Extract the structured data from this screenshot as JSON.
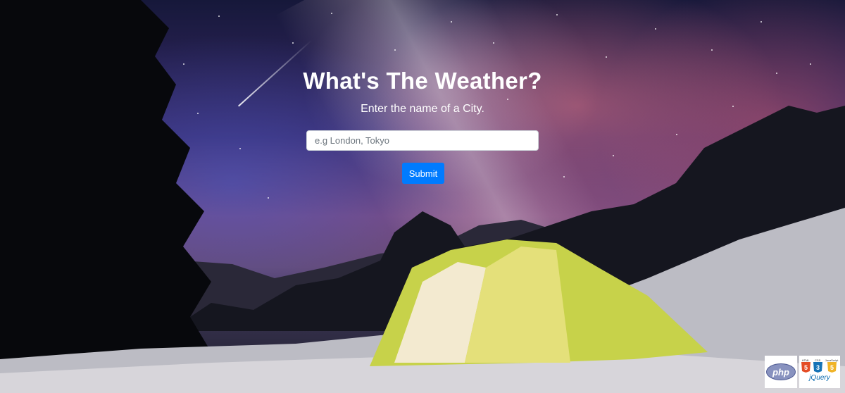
{
  "hero": {
    "title": "What's The Weather?",
    "subtitle": "Enter the name of a City."
  },
  "search": {
    "value": "",
    "placeholder": "e.g London, Tokyo"
  },
  "form": {
    "submit_label": "Submit"
  },
  "badges": {
    "php_text": "php",
    "html_label": "HTML",
    "css_label": "CSS",
    "js_label": "JavaScript",
    "html_glyph": "5",
    "css_glyph": "3",
    "js_glyph": "5",
    "jquery_label": "jQuery"
  },
  "colors": {
    "submit_bg": "#007bff",
    "php_purple": "#8892bf",
    "html_orange": "#e44d26",
    "css_blue": "#1572b6",
    "js_yellow": "#f7df1e",
    "jquery_blue": "#0769ad"
  }
}
